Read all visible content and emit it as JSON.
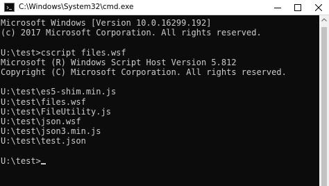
{
  "window": {
    "title": "C:\\Windows\\System32\\cmd.exe",
    "app_icon": "console-icon",
    "buttons": {
      "minimize_icon": "minimize-icon",
      "maximize_icon": "maximize-icon",
      "close_icon": "close-icon"
    }
  },
  "console": {
    "colors": {
      "background": "#0c0c0c",
      "foreground": "#cccccc"
    },
    "lines": [
      "Microsoft Windows [Version 10.0.16299.192]",
      "(c) 2017 Microsoft Corporation. All rights reserved.",
      "",
      "U:\\test>cscript files.wsf",
      "Microsoft (R) Windows Script Host Version 5.812",
      "Copyright (C) Microsoft Corporation. All rights reserved.",
      "",
      "U:\\test\\es5-shim.min.js",
      "U:\\test\\files.wsf",
      "U:\\test\\FileUtility.js",
      "U:\\test\\json.wsf",
      "U:\\test\\json3.min.js",
      "U:\\test\\test.json",
      "",
      "U:\\test>"
    ]
  },
  "scrollbar": {
    "up_icon": "scroll-up-icon"
  }
}
